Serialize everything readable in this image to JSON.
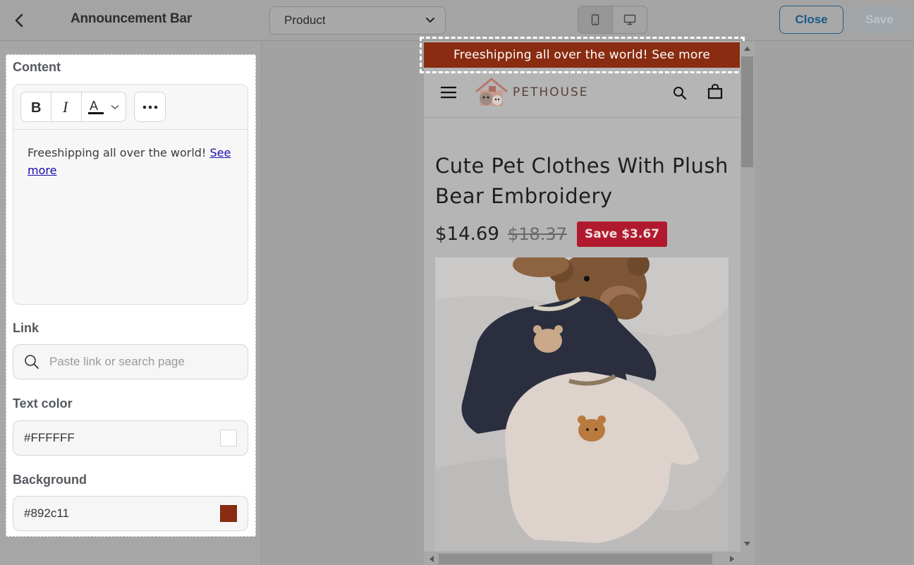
{
  "header": {
    "back_label": "",
    "title": "Announcement Bar",
    "template_select": {
      "value": "Product"
    },
    "device_modes": [
      "mobile",
      "desktop"
    ],
    "active_device": "mobile",
    "close_label": "Close",
    "save_label": "Save"
  },
  "settings": {
    "content": {
      "label": "Content",
      "text": "Freeshipping all over the world! ",
      "link_text": "See more"
    },
    "link": {
      "label": "Link",
      "placeholder": "Paste link or search page",
      "value": ""
    },
    "text_color": {
      "label": "Text color",
      "value": "#FFFFFF"
    },
    "background": {
      "label": "Background",
      "value": "#892c11"
    }
  },
  "preview": {
    "announcement": "Freeshipping all over the world! See more",
    "brand": "PETHOUSE",
    "product_title": "Cute Pet Clothes With Plush Bear Embroidery",
    "price": "$14.69",
    "compare_price": "$18.37",
    "save_badge": "Save $3.67"
  },
  "colors": {
    "announcement_bg": "#892c11",
    "announcement_text": "#FFFFFF",
    "close_accent": "#1c5887",
    "save_badge": "#b11a2e"
  }
}
